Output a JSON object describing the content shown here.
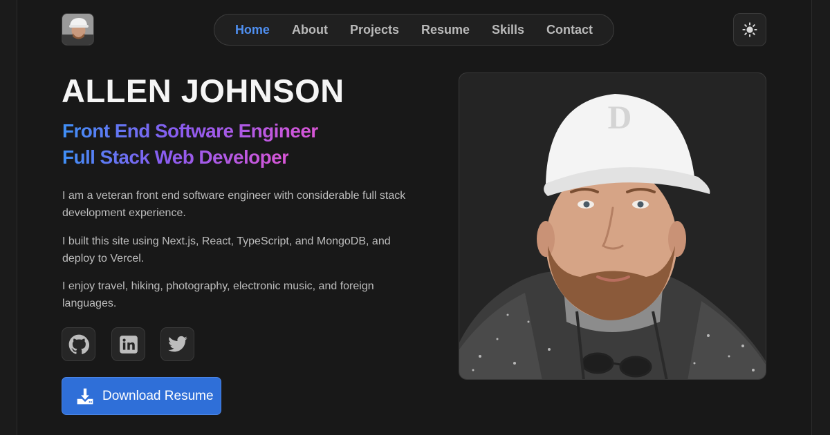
{
  "nav": {
    "items": [
      {
        "label": "Home",
        "active": true
      },
      {
        "label": "About",
        "active": false
      },
      {
        "label": "Projects",
        "active": false
      },
      {
        "label": "Resume",
        "active": false
      },
      {
        "label": "Skills",
        "active": false
      },
      {
        "label": "Contact",
        "active": false
      }
    ]
  },
  "hero": {
    "name": "ALLEN JOHNSON",
    "role_line1": "Front End Software Engineer",
    "role_line2": "Full Stack Web Developer",
    "paragraphs": [
      "I am a veteran front end software engineer with considerable full stack development experience.",
      "I built this site using Next.js, React, TypeScript, and MongoDB, and deploy to Vercel.",
      "I enjoy travel, hiking, photography, electronic music, and foreign languages."
    ],
    "download_label": "Download Resume"
  },
  "social": {
    "icons": [
      "github-icon",
      "linkedin-icon",
      "twitter-icon"
    ]
  },
  "colors": {
    "accent": "#4f8ff0",
    "gradient_start": "#3f8ff5",
    "gradient_mid": "#8a5cf0",
    "gradient_end": "#d956d6",
    "button": "#2f6fd8"
  }
}
